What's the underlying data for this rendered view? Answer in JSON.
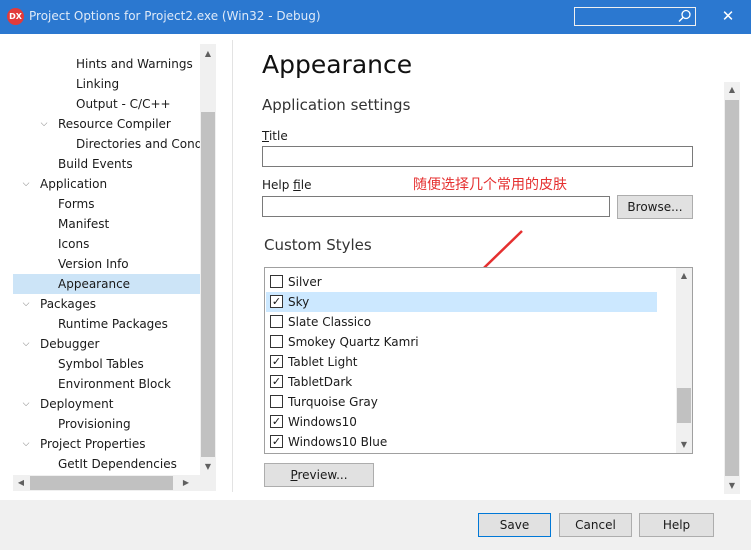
{
  "window": {
    "title": "Project Options for Project2.exe  (Win32 - Debug)",
    "app_icon": "DX",
    "close_glyph": "✕",
    "search_value": ""
  },
  "tree": {
    "items": [
      {
        "label": "Hints and Warnings",
        "indent": 3,
        "expand": ""
      },
      {
        "label": "Linking",
        "indent": 3,
        "expand": ""
      },
      {
        "label": "Output - C/C++",
        "indent": 3,
        "expand": ""
      },
      {
        "label": "Resource Compiler",
        "indent": 2,
        "expand": "v"
      },
      {
        "label": "Directories and Conditionals",
        "indent": 3,
        "expand": ""
      },
      {
        "label": "Build Events",
        "indent": 2,
        "expand": ""
      },
      {
        "label": "Application",
        "indent": 1,
        "expand": "v"
      },
      {
        "label": "Forms",
        "indent": 2,
        "expand": ""
      },
      {
        "label": "Manifest",
        "indent": 2,
        "expand": ""
      },
      {
        "label": "Icons",
        "indent": 2,
        "expand": ""
      },
      {
        "label": "Version Info",
        "indent": 2,
        "expand": ""
      },
      {
        "label": "Appearance",
        "indent": 2,
        "expand": "",
        "selected": true
      },
      {
        "label": "Packages",
        "indent": 1,
        "expand": "v"
      },
      {
        "label": "Runtime Packages",
        "indent": 2,
        "expand": ""
      },
      {
        "label": "Debugger",
        "indent": 1,
        "expand": "v"
      },
      {
        "label": "Symbol Tables",
        "indent": 2,
        "expand": ""
      },
      {
        "label": "Environment Block",
        "indent": 2,
        "expand": ""
      },
      {
        "label": "Deployment",
        "indent": 1,
        "expand": "v"
      },
      {
        "label": "Provisioning",
        "indent": 2,
        "expand": ""
      },
      {
        "label": "Project Properties",
        "indent": 1,
        "expand": "v"
      },
      {
        "label": "GetIt Dependencies",
        "indent": 2,
        "expand": ""
      }
    ]
  },
  "main": {
    "page_title": "Appearance",
    "section_title": "Application settings",
    "title_label_first": "T",
    "title_label_rest": "itle",
    "title_value": "",
    "helpfile_label_pre": "Help ",
    "helpfile_label_u": "f",
    "helpfile_label_post": "ile",
    "helpfile_value": "",
    "browse_label": "Browse...",
    "annotation": "随便选择几个常用的皮肤",
    "annotation_color": "#e53030",
    "custom_styles_title": "Custom Styles",
    "styles": [
      {
        "label": "Silver",
        "checked": false
      },
      {
        "label": "Sky",
        "checked": true,
        "highlighted": true
      },
      {
        "label": "Slate Classico",
        "checked": false
      },
      {
        "label": "Smokey Quartz Kamri",
        "checked": false
      },
      {
        "label": "Tablet Light",
        "checked": true
      },
      {
        "label": "TabletDark",
        "checked": true
      },
      {
        "label": "Turquoise Gray",
        "checked": false
      },
      {
        "label": "Windows10",
        "checked": true
      },
      {
        "label": "Windows10 Blue",
        "checked": true
      }
    ],
    "preview_label_u": "P",
    "preview_label_rest": "review..."
  },
  "footer": {
    "save_label": "Save",
    "cancel_label": "Cancel",
    "help_label": "Help"
  },
  "colors": {
    "titlebar": "#2b78d0",
    "selection": "#cce4f7",
    "accent_border": "#0078d7"
  }
}
